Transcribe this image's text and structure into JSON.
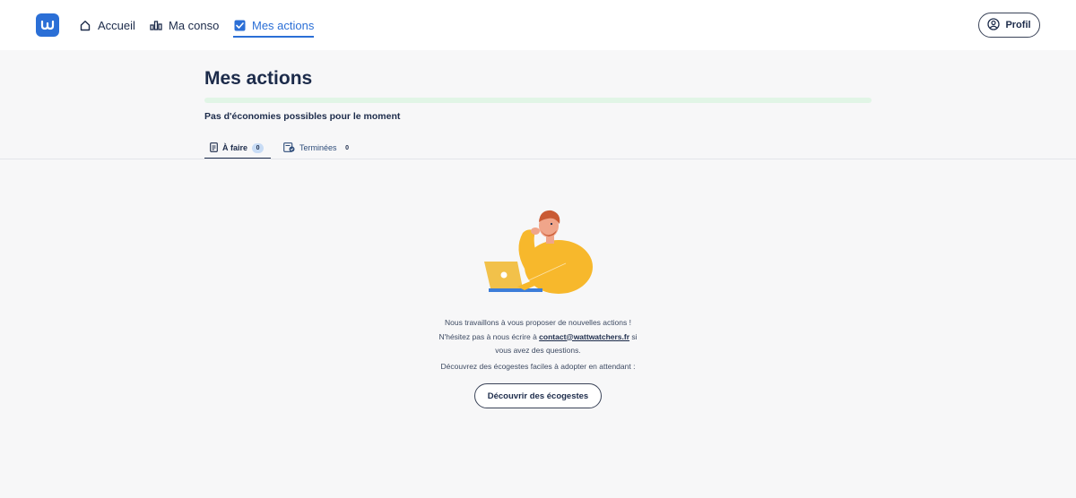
{
  "header": {
    "nav": [
      {
        "label": "Accueil",
        "icon": "home-icon"
      },
      {
        "label": "Ma conso",
        "icon": "bar-chart-icon"
      },
      {
        "label": "Mes actions",
        "icon": "checkbox-icon",
        "active": true
      }
    ],
    "profile_label": "Profil",
    "accent_color": "#2b6fd6"
  },
  "main": {
    "title": "Mes actions",
    "progress": 0,
    "subtitle": "Pas d'économies possibles pour le moment",
    "tabs": [
      {
        "label": "À faire",
        "count": "0",
        "active": true
      },
      {
        "label": "Terminées",
        "count": "0"
      }
    ]
  },
  "empty_state": {
    "line1": "Nous travaillons à vous proposer de nouvelles actions !",
    "line2_prefix": "N'hésitez pas à nous écrire à ",
    "email": "contact@wattwatchers.fr",
    "line2_suffix": " si",
    "line3": "vous avez des questions.",
    "discover_text": "Découvrez des écogestes faciles à adopter en attendant :",
    "cta_label": "Découvrir des écogestes"
  }
}
